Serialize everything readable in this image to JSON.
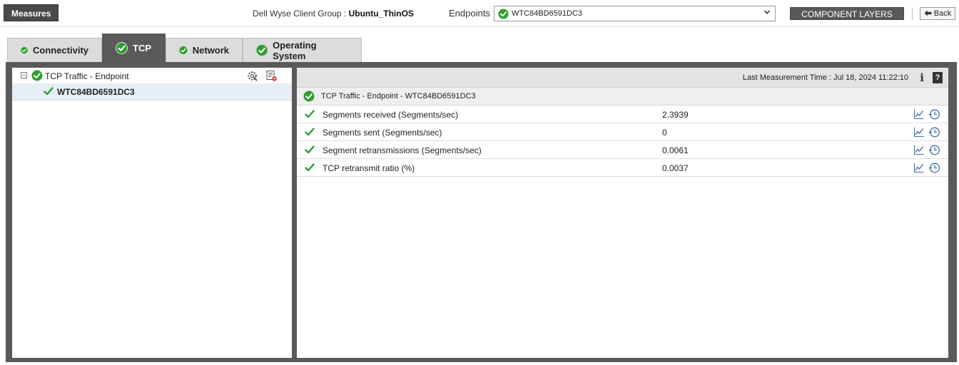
{
  "topbar": {
    "measures_label": "Measures",
    "group_prefix": "Dell Wyse Client Group : ",
    "group_name": "Ubuntu_ThinOS",
    "endpoints_label": "Endpoints",
    "endpoint_selected": "WTC84BD6591DC3",
    "component_layers_label": "COMPONENT LAYERS",
    "back_label": "Back"
  },
  "tabs": [
    {
      "label": "Connectivity",
      "active": false
    },
    {
      "label": "TCP",
      "active": true
    },
    {
      "label": "Network",
      "active": false
    },
    {
      "label": "Operating System",
      "active": false
    }
  ],
  "tree": {
    "root_label": "TCP Traffic - Endpoint",
    "child_label": "WTC84BD6591DC3"
  },
  "details": {
    "last_measurement": "Last Measurement Time : Jul 18, 2024 11:22:10",
    "section_title": "TCP Traffic - Endpoint - WTC84BD6591DC3",
    "rows": [
      {
        "name": "Segments received (Segments/sec)",
        "value": "2.3939"
      },
      {
        "name": "Segments sent (Segments/sec)",
        "value": "0"
      },
      {
        "name": "Segment retransmissions (Segments/sec)",
        "value": "0.0061"
      },
      {
        "name": "TCP retransmit ratio (%)",
        "value": "0.0037"
      }
    ]
  },
  "colors": {
    "status_ok": "#2e9e2e",
    "tab_active_bg": "#5a5a5a",
    "frame_bg": "#5a5a5a",
    "selected_row_bg": "#e6eff7"
  },
  "icons": {
    "status": "check-circle-icon",
    "tick": "checkmark-icon",
    "config": "gear-wrench-icon",
    "report": "report-icon",
    "graph": "line-graph-icon",
    "history": "history-clock-icon",
    "info": "info-icon",
    "help": "help-icon",
    "back": "back-arrow-icon",
    "dropdown": "chevron-down-icon",
    "collapse": "collapse-icon"
  }
}
